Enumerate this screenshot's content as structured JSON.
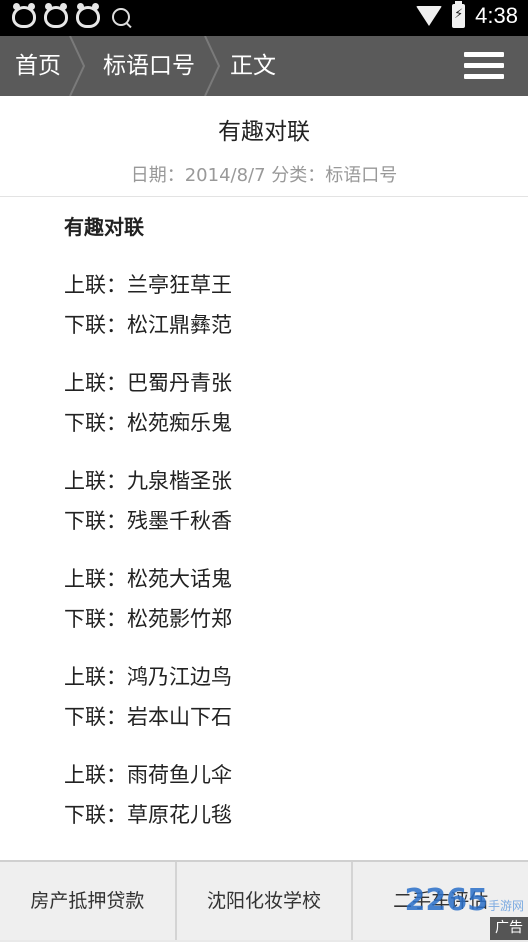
{
  "status_bar": {
    "time": "4:38",
    "icons": [
      "cat-app-icon",
      "cat-app-icon",
      "cat-app-icon",
      "search-icon",
      "wifi-icon",
      "battery-charging-icon"
    ]
  },
  "nav": {
    "breadcrumbs": [
      "首页",
      "标语口号",
      "正文"
    ],
    "menu_icon": "hamburger-menu-icon"
  },
  "article": {
    "title": "有趣对联",
    "meta": "日期：2014/8/7 分类：标语口号",
    "heading": "有趣对联",
    "couplets": [
      {
        "upper": "上联：兰亭狂草王",
        "lower": "下联：松江鼎彝范"
      },
      {
        "upper": "上联：巴蜀丹青张",
        "lower": "下联：松苑痴乐鬼"
      },
      {
        "upper": "上联：九泉楷圣张",
        "lower": "下联：残墨千秋香"
      },
      {
        "upper": "上联：松苑大话鬼",
        "lower": "下联：松苑影竹郑"
      },
      {
        "upper": "上联：鸿乃江边鸟",
        "lower": "下联：岩本山下石"
      },
      {
        "upper": "上联：雨荷鱼儿伞",
        "lower": "下联：草原花儿毯"
      }
    ]
  },
  "ads": {
    "items": [
      "房产抵押贷款",
      "沈阳化妆学校",
      "二手车评估"
    ],
    "tag": "广告",
    "watermark": "2265",
    "watermark_sub": "手游网"
  },
  "colors": {
    "navbar": "#5a5a5a",
    "status_bar": "#000000",
    "meta_text": "#999999"
  }
}
